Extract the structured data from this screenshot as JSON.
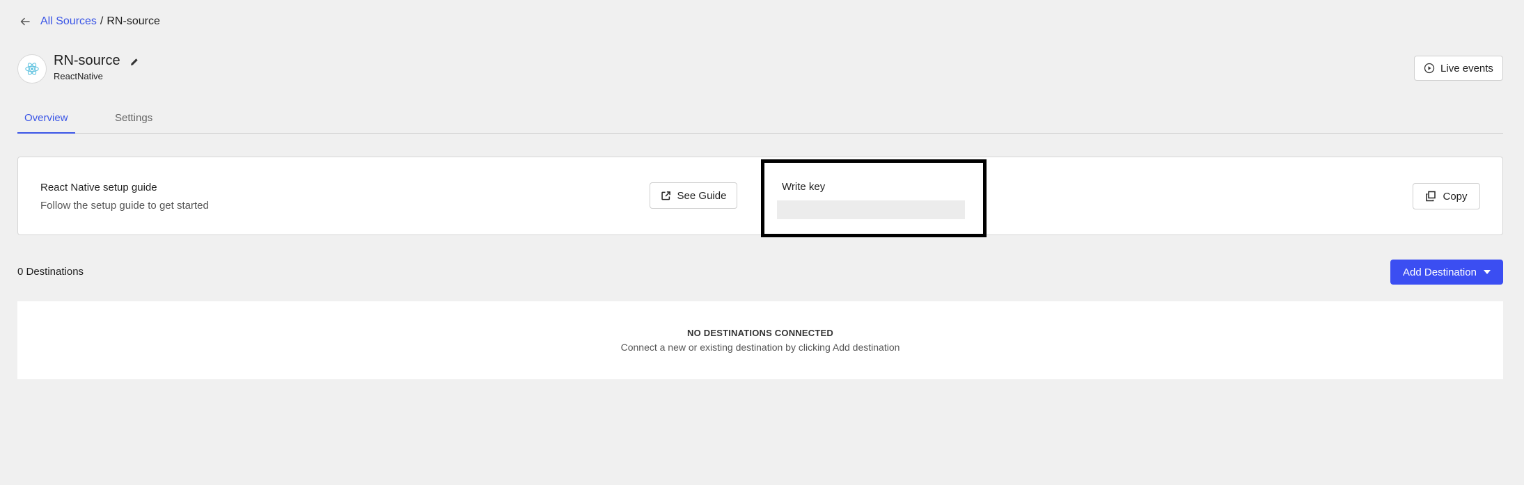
{
  "breadcrumb": {
    "back_icon": "arrow-left-icon",
    "parent_label": "All Sources",
    "separator": "/",
    "current_label": "RN-source"
  },
  "source": {
    "name": "RN-source",
    "type": "ReactNative",
    "icon": "react-icon",
    "edit_icon": "pencil-icon"
  },
  "header": {
    "live_events_label": "Live events",
    "live_events_icon": "play-circle-icon"
  },
  "tabs": [
    {
      "label": "Overview",
      "active": true
    },
    {
      "label": "Settings",
      "active": false
    }
  ],
  "setup_card": {
    "title": "React Native setup guide",
    "subtitle": "Follow the setup guide to get started",
    "see_guide_label": "See Guide",
    "see_guide_icon": "external-link-icon",
    "write_key_label": "Write key",
    "write_key_value": "",
    "copy_label": "Copy",
    "copy_icon": "copy-icon"
  },
  "destinations": {
    "count_label": "0 Destinations",
    "add_button_label": "Add Destination",
    "empty_title": "NO DESTINATIONS CONNECTED",
    "empty_subtitle": "Connect a new or existing destination by clicking Add destination"
  },
  "colors": {
    "accent": "#3a55e6",
    "primary_button": "#3b4ef2",
    "background": "#f0f0f0"
  }
}
